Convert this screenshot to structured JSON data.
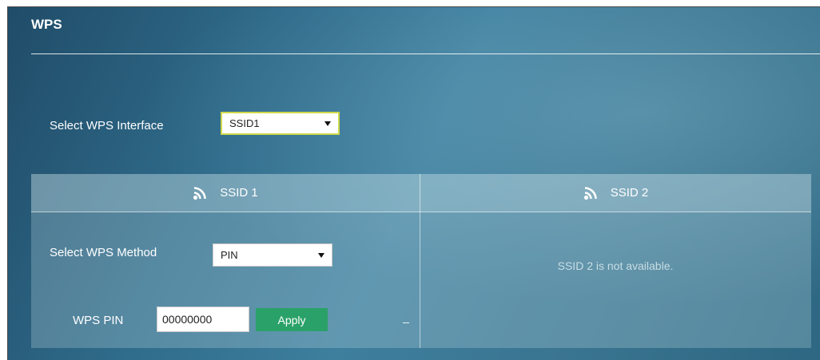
{
  "page": {
    "title": "WPS"
  },
  "interface": {
    "label": "Select WPS Interface",
    "selected": "SSID1"
  },
  "ssid1": {
    "header": "SSID 1",
    "method_label": "Select WPS Method",
    "method_selected": "PIN",
    "pin_label": "WPS PIN",
    "pin_value": "00000000",
    "apply_label": "Apply"
  },
  "ssid2": {
    "header": "SSID 2",
    "message": "SSID 2 is not available."
  },
  "icons": {
    "ssid_header": "wifi-signal-icon",
    "dropdown": "dropdown-arrow-icon"
  },
  "colors": {
    "accent_button": "#2aa168",
    "select_highlight": "#cfd84a"
  }
}
